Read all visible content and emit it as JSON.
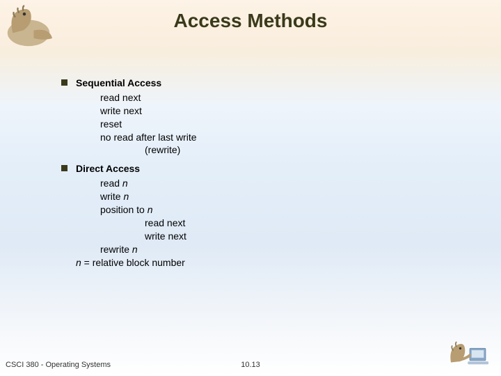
{
  "title": "Access Methods",
  "sections": [
    {
      "heading": "Sequential Access",
      "lines": [
        {
          "level": 1,
          "text": "read next"
        },
        {
          "level": 1,
          "text": "write next"
        },
        {
          "level": 1,
          "text": "reset"
        },
        {
          "level": 1,
          "text": "no read after last write"
        },
        {
          "level": 2,
          "text": "(rewrite)"
        }
      ]
    },
    {
      "heading": "Direct Access",
      "lines": [
        {
          "level": 1,
          "text": "read n",
          "italic_after": 5
        },
        {
          "level": 1,
          "text": "write n",
          "italic_after": 6
        },
        {
          "level": 1,
          "text": "position to n",
          "italic_after": 12
        },
        {
          "level": 2,
          "text": "read next"
        },
        {
          "level": 2,
          "text": "write next"
        },
        {
          "level": 1,
          "text": "rewrite n",
          "italic_after": 8
        },
        {
          "level": 1,
          "text": "n = relative block number",
          "italic_before": 1,
          "note_plain": true
        }
      ],
      "note": {
        "prefix_italic": "n",
        "rest": " = relative block number"
      }
    }
  ],
  "footer": {
    "left": "CSCI 380 - Operating Systems",
    "center": "10.13"
  },
  "icons": {
    "top_left": "dinosaur-mascot-icon",
    "bottom_right": "dinosaur-computer-icon"
  }
}
